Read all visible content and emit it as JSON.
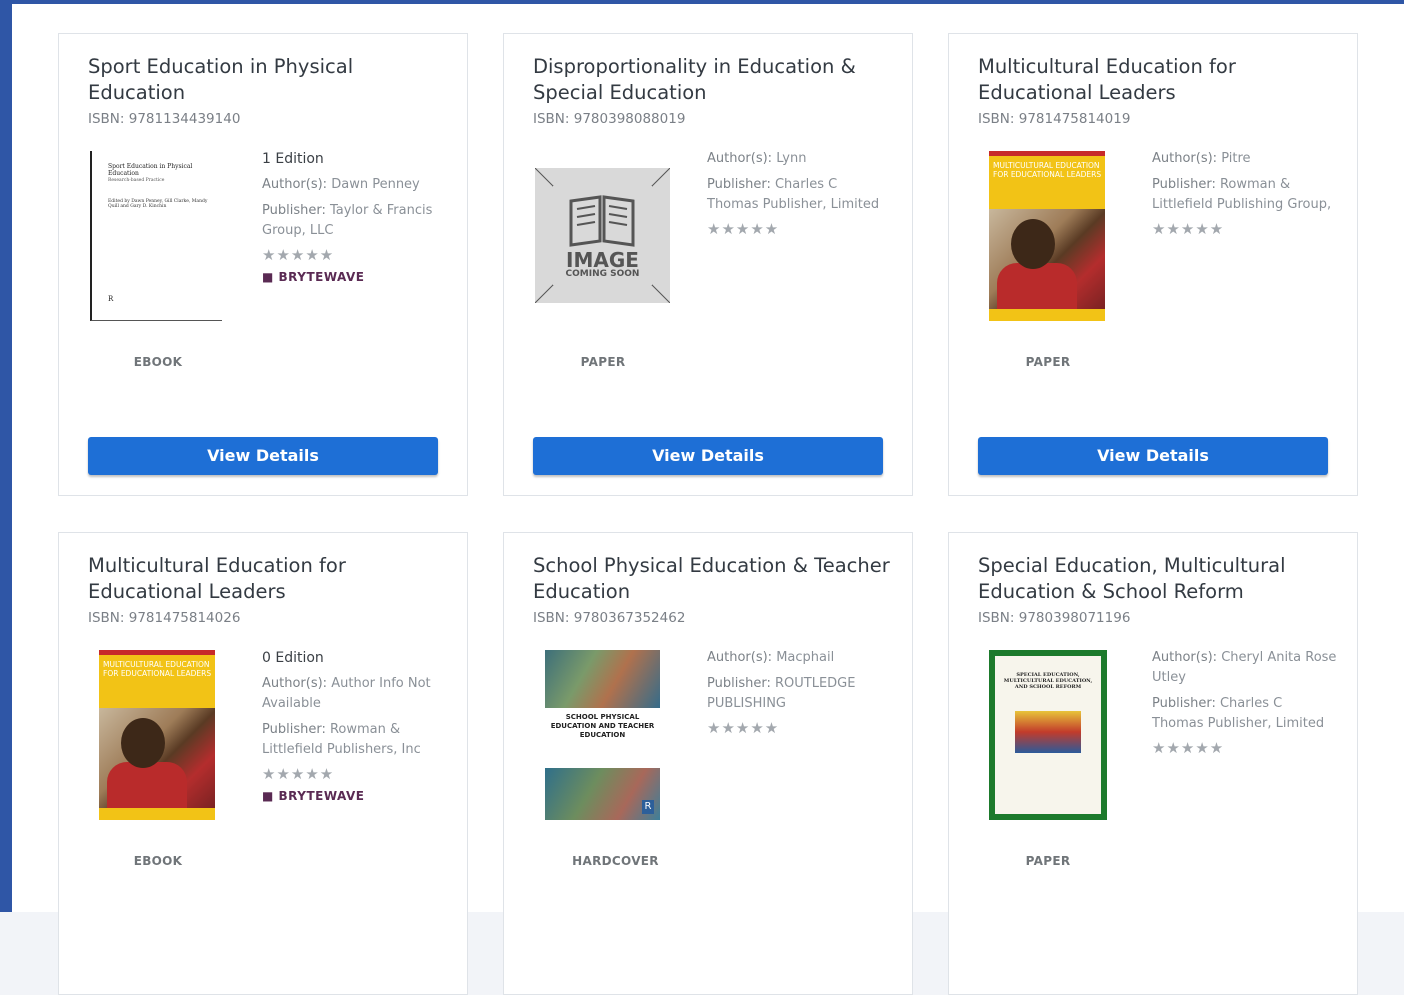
{
  "books": [
    {
      "title": "Sport Education in Physical Education",
      "isbn": "ISBN: 9781134439140",
      "edition": "1 Edition",
      "author_label": "Author(s):",
      "author": "Dawn Penney",
      "publisher_label": "Publisher:",
      "publisher": "Taylor & Francis Group, LLC",
      "stars": "★★★★★",
      "brand": "BRYTEWAVE",
      "format": "EBOOK",
      "button": "View Details",
      "cover": {
        "title": "Sport Education in Physical Education",
        "subtitle": "Research-based Practice",
        "editors": "Edited by Dawn Penney, Gill Clarke, Mandy Quill and Gary D. Kinchin",
        "logo": "R"
      }
    },
    {
      "title": "Disproportionality in Education & Special Education",
      "isbn": "ISBN: 9780398088019",
      "author_label": "Author(s):",
      "author": "Lynn",
      "publisher_label": "Publisher:",
      "publisher": "Charles C Thomas Publisher, Limited",
      "stars": "★★★★★",
      "format": "PAPER",
      "button": "View Details",
      "cover": {
        "line1": "IMAGE",
        "line2": "COMING SOON"
      }
    },
    {
      "title": "Multicultural Education for Educational Leaders",
      "isbn": "ISBN: 9781475814019",
      "author_label": "Author(s):",
      "author": "Pitre",
      "publisher_label": "Publisher:",
      "publisher": "Rowman & Littlefield Publishing Group,",
      "stars": "★★★★★",
      "format": "PAPER",
      "button": "View Details",
      "cover": {
        "title": "MULTICULTURAL EDUCATION FOR EDUCATIONAL LEADERS"
      }
    },
    {
      "title": "Multicultural Education for Educational Leaders",
      "isbn": "ISBN: 9781475814026",
      "edition": "0 Edition",
      "author_label": "Author(s):",
      "author": "Author Info Not Available",
      "publisher_label": "Publisher:",
      "publisher": "Rowman & Littlefield Publishers, Inc",
      "stars": "★★★★★",
      "brand": "BRYTEWAVE",
      "format": "EBOOK",
      "cover": {
        "title": "MULTICULTURAL EDUCATION FOR EDUCATIONAL LEADERS"
      }
    },
    {
      "title": "School Physical Education & Teacher Education",
      "isbn": "ISBN: 9780367352462",
      "author_label": "Author(s):",
      "author": "Macphail",
      "publisher_label": "Publisher:",
      "publisher": "ROUTLEDGE PUBLISHING",
      "stars": "★★★★★",
      "format": "HARDCOVER",
      "cover": {
        "title": "SCHOOL PHYSICAL EDUCATION AND TEACHER EDUCATION",
        "logo": "R"
      }
    },
    {
      "title": "Special Education, Multicultural Education & School Reform",
      "isbn": "ISBN: 9780398071196",
      "author_label": "Author(s):",
      "author": "Cheryl Anita Rose Utley",
      "publisher_label": "Publisher:",
      "publisher": "Charles C Thomas Publisher, Limited",
      "stars": "★★★★★",
      "format": "PAPER",
      "cover": {
        "title": "SPECIAL EDUCATION, MULTICULTURAL EDUCATION, AND SCHOOL REFORM"
      }
    }
  ],
  "colors": {
    "button": "#1e6fd6",
    "frame": "#2f56a6",
    "brand": "#5a2a53"
  }
}
